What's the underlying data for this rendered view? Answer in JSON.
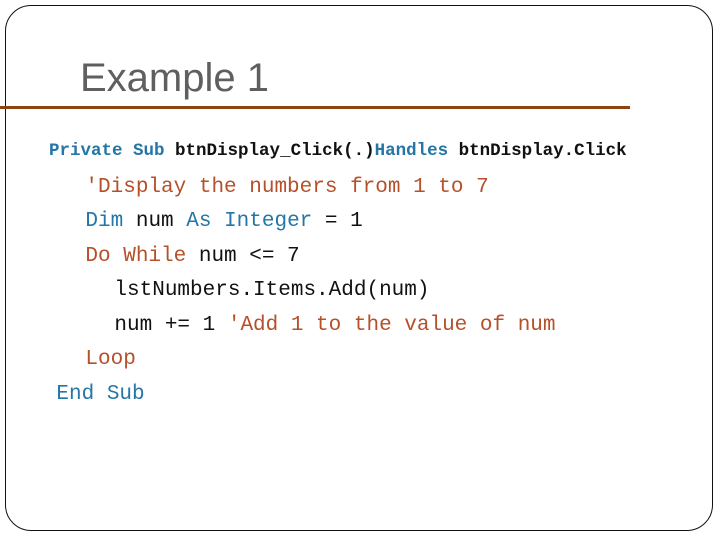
{
  "slide": {
    "title": "Example 1",
    "colors": {
      "title": "#5f5f5f",
      "rule": "#8b4513",
      "keyword": "#2476a6",
      "comment_and_loop_keyword": "#b5502a",
      "plain": "#111111"
    },
    "code_lines": [
      {
        "tokens": [
          {
            "text": "Private Sub ",
            "kind": "keyword"
          },
          {
            "text": "btnDisplay_Click(.)",
            "kind": "plain"
          },
          {
            "text": "Handles ",
            "kind": "keyword"
          },
          {
            "text": "btnDisplay.Click",
            "kind": "plain"
          }
        ]
      },
      {
        "tokens": [
          {
            "text": "'Display the numbers from 1 to 7",
            "kind": "comment"
          }
        ]
      },
      {
        "tokens": [
          {
            "text": "Dim ",
            "kind": "keyword"
          },
          {
            "text": "num ",
            "kind": "plain"
          },
          {
            "text": "As Integer ",
            "kind": "keyword"
          },
          {
            "text": "= 1",
            "kind": "plain"
          }
        ]
      },
      {
        "tokens": [
          {
            "text": "Do While ",
            "kind": "loop-keyword"
          },
          {
            "text": "num <= 7",
            "kind": "plain"
          }
        ]
      },
      {
        "tokens": [
          {
            "text": "lstNumbers.Items.Add(num)",
            "kind": "plain"
          }
        ]
      },
      {
        "tokens": [
          {
            "text": "num += 1 ",
            "kind": "plain"
          },
          {
            "text": "'Add 1 to the value of num",
            "kind": "comment"
          }
        ]
      },
      {
        "tokens": [
          {
            "text": "Loop",
            "kind": "loop-keyword"
          }
        ]
      },
      {
        "tokens": [
          {
            "text": "End Sub",
            "kind": "keyword"
          }
        ]
      }
    ]
  }
}
